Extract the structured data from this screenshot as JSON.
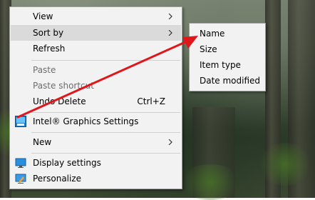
{
  "context_menu": {
    "items": [
      {
        "label": "View"
      },
      {
        "label": "Sort by"
      },
      {
        "label": "Refresh"
      },
      {
        "label": "Paste"
      },
      {
        "label": "Paste shortcut"
      },
      {
        "label": "Undo Delete",
        "shortcut": "Ctrl+Z"
      },
      {
        "label": "Intel® Graphics Settings"
      },
      {
        "label": "New"
      },
      {
        "label": "Display settings"
      },
      {
        "label": "Personalize"
      }
    ]
  },
  "sort_submenu": {
    "items": [
      {
        "label": "Name"
      },
      {
        "label": "Size"
      },
      {
        "label": "Item type"
      },
      {
        "label": "Date modified"
      }
    ]
  },
  "colors": {
    "menu_background": "#f2f2f2",
    "highlight": "#dadada",
    "disabled_text": "#6d6d6d",
    "annotation_arrow": "#e0161b"
  }
}
